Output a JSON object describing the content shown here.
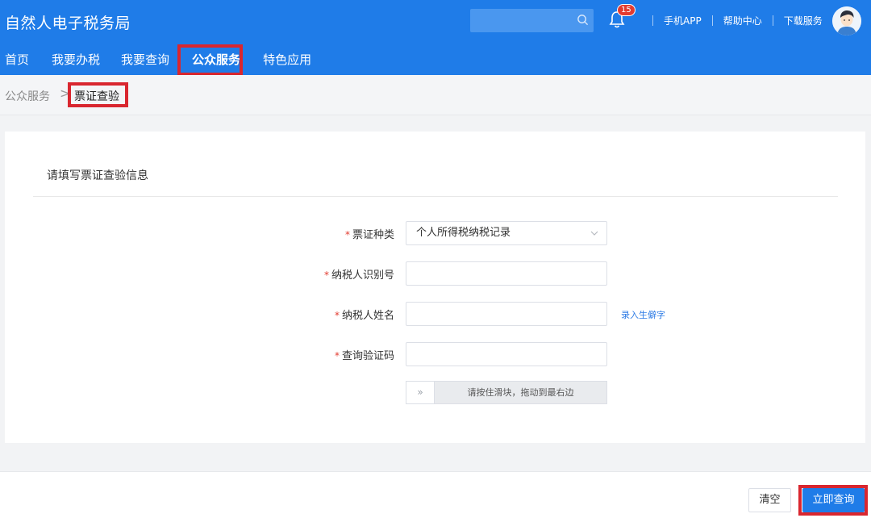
{
  "header": {
    "app_title": "自然人电子税务局",
    "notification_count": "15",
    "links": [
      "手机APP",
      "帮助中心",
      "下载服务"
    ],
    "bg_color": "#1f7ce8"
  },
  "nav": {
    "items": [
      {
        "label": "首页"
      },
      {
        "label": "我要办税"
      },
      {
        "label": "我要查询"
      },
      {
        "label": "公众服务",
        "active": true
      },
      {
        "label": "特色应用"
      }
    ]
  },
  "breadcrumb": {
    "parent": "公众服务",
    "separator": ">",
    "current": "票证查验"
  },
  "form": {
    "section_title": "请填写票证查验信息",
    "required_mark": "*",
    "fields": {
      "ticket_type": {
        "label": "票证种类",
        "value": "个人所得税纳税记录"
      },
      "taxpayer_id": {
        "label": "纳税人识别号",
        "value": ""
      },
      "taxpayer_name": {
        "label": "纳税人姓名",
        "value": "",
        "helper_link": "录入生僻字"
      },
      "verify_code": {
        "label": "查询验证码",
        "value": ""
      }
    },
    "slider": {
      "handle": "»",
      "text": "请按住滑块，拖动到最右边"
    }
  },
  "footer": {
    "clear_label": "清空",
    "query_label": "立即查询"
  },
  "colors": {
    "primary": "#1f7ce8",
    "highlight_box": "#d9262f",
    "required": "#e23b30"
  }
}
